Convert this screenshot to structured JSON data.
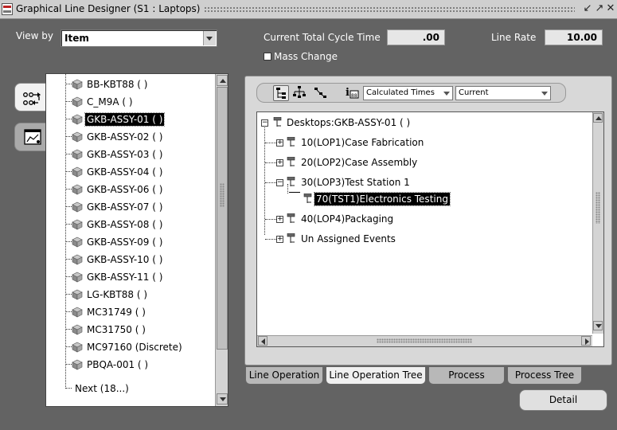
{
  "window": {
    "title": "Graphical Line Designer (S1 : Laptops)"
  },
  "header": {
    "view_by_label": "View by",
    "view_by_value": "Item",
    "cycle_time_label": "Current Total Cycle Time",
    "cycle_time_value": ".00",
    "line_rate_label": "Line Rate",
    "line_rate_value": "10.00",
    "mass_change_label": "Mass Change"
  },
  "left_tree": {
    "items": [
      {
        "label": "BB-KBT88 ( )"
      },
      {
        "label": "C_M9A ( )"
      },
      {
        "label": "GKB-ASSY-01 ( )",
        "selected": true
      },
      {
        "label": "GKB-ASSY-02 ( )"
      },
      {
        "label": "GKB-ASSY-03 ( )"
      },
      {
        "label": "GKB-ASSY-04 ( )"
      },
      {
        "label": "GKB-ASSY-06 ( )"
      },
      {
        "label": "GKB-ASSY-07 ( )"
      },
      {
        "label": "GKB-ASSY-08 ( )"
      },
      {
        "label": "GKB-ASSY-09 ( )"
      },
      {
        "label": "GKB-ASSY-10 ( )"
      },
      {
        "label": "GKB-ASSY-11 ( )"
      },
      {
        "label": "LG-KBT88 ( )"
      },
      {
        "label": "MC31749 ( )"
      },
      {
        "label": "MC31750 ( )"
      },
      {
        "label": "MC97160 (Discrete)"
      },
      {
        "label": "PBQA-001 ( )"
      }
    ],
    "next_label": "Next (18...)"
  },
  "toolbar": {
    "times_select": "Calculated Times",
    "version_select": "Current"
  },
  "operation_tree": {
    "root": "Desktops:GKB-ASSY-01 ( )",
    "nodes": [
      {
        "label": "10(LOP1)Case Fabrication"
      },
      {
        "label": "20(LOP2)Case Assembly"
      },
      {
        "label": "30(LOP3)Test Station 1"
      },
      {
        "label": "70(TST1)Electronics Testing",
        "selected": true
      },
      {
        "label": "40(LOP4)Packaging"
      },
      {
        "label": "Un Assigned Events"
      }
    ]
  },
  "tabs": [
    {
      "label": "Line Operation"
    },
    {
      "label": "Line Operation Tree",
      "active": true
    },
    {
      "label": "Process"
    },
    {
      "label": "Process Tree"
    }
  ],
  "detail_button": "Detail"
}
